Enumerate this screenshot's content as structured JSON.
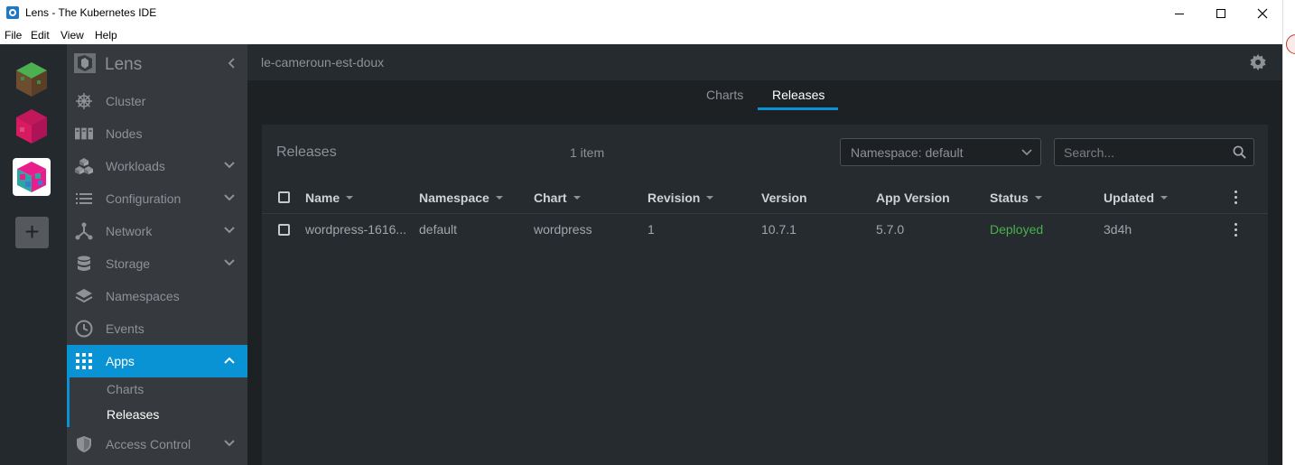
{
  "window": {
    "title": "Lens - The Kubernetes IDE",
    "menu": [
      "File",
      "Edit",
      "View",
      "Help"
    ]
  },
  "sidebar": {
    "app_name": "Lens",
    "items": [
      {
        "label": "Cluster",
        "icon": "helm-wheel-icon"
      },
      {
        "label": "Nodes",
        "icon": "nodes-icon"
      },
      {
        "label": "Workloads",
        "icon": "cubes-icon"
      },
      {
        "label": "Configuration",
        "icon": "list-icon"
      },
      {
        "label": "Network",
        "icon": "network-icon"
      },
      {
        "label": "Storage",
        "icon": "database-icon"
      },
      {
        "label": "Namespaces",
        "icon": "layers-icon"
      },
      {
        "label": "Events",
        "icon": "clock-icon"
      },
      {
        "label": "Apps",
        "icon": "apps-grid-icon"
      },
      {
        "label": "Access Control",
        "icon": "shield-icon"
      }
    ],
    "apps_sub": [
      "Charts",
      "Releases"
    ]
  },
  "topbar": {
    "cluster_name": "le-cameroun-est-doux"
  },
  "tabs": [
    "Charts",
    "Releases"
  ],
  "releases": {
    "title": "Releases",
    "count": "1 item",
    "namespace_select": "Namespace: default",
    "search_placeholder": "Search...",
    "columns": [
      "Name",
      "Namespace",
      "Chart",
      "Revision",
      "Version",
      "App Version",
      "Status",
      "Updated"
    ],
    "rows": [
      {
        "name": "wordpress-1616...",
        "namespace": "default",
        "chart": "wordpress",
        "revision": "1",
        "version": "10.7.1",
        "app_version": "5.7.0",
        "status": "Deployed",
        "updated": "3d4h"
      }
    ]
  },
  "colors": {
    "accent": "#0a93d4",
    "status_deployed": "#48b14d"
  }
}
